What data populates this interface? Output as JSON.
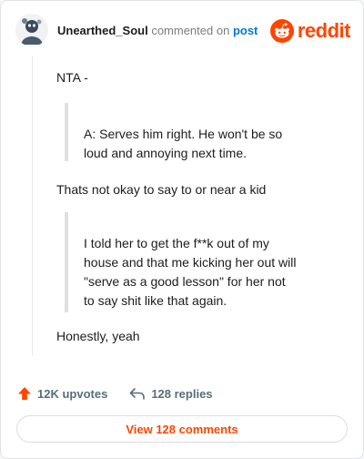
{
  "header": {
    "username": "Unearthed_Soul",
    "commented_text": "commented on",
    "post_link": "post",
    "logo_text": "reddit",
    "brand_color": "#ff4500",
    "avatar_icon": "avatar-icon",
    "logo_icon": "reddit-alien-icon"
  },
  "comment": {
    "paragraph_1": "NTA -",
    "quote_1": "A: Serves him right. He won't be so loud and annoying next time.",
    "paragraph_2": "Thats not okay to say to or near a kid",
    "quote_2": "I told her to get the f**k out of my house and that me kicking her out will \"serve as a good lesson\" for her not to say shit like that again.",
    "paragraph_3": "Honestly, yeah"
  },
  "actions": {
    "upvotes": "12K upvotes",
    "upvote_icon": "upvote-arrow-icon",
    "replies": "128 replies",
    "reply_icon": "reply-arrow-icon"
  },
  "footer": {
    "view_comments": "View 128 comments"
  }
}
